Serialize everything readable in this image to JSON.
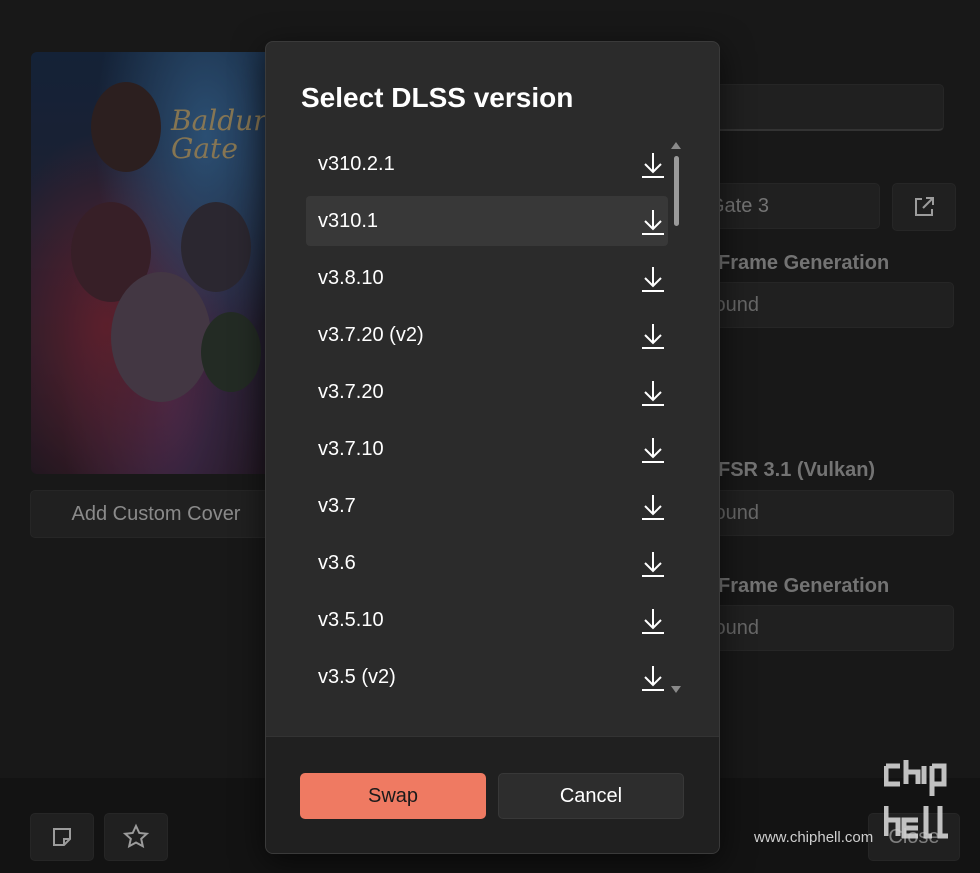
{
  "background": {
    "add_cover_label": "Add Custom Cover",
    "cover_art_text": "Baldur's Gate",
    "game_name_field": "Gate 3",
    "section_labels": [
      "Frame Generation",
      "FSR 3.1 (Vulkan)",
      "Frame Generation"
    ],
    "status_values": [
      "found",
      "found",
      "found"
    ],
    "close_label": "Close"
  },
  "dialog": {
    "title": "Select DLSS version",
    "versions": [
      {
        "label": "v310.2.1",
        "selected": false
      },
      {
        "label": "v310.1",
        "selected": true
      },
      {
        "label": "v3.8.10",
        "selected": false
      },
      {
        "label": "v3.7.20 (v2)",
        "selected": false
      },
      {
        "label": "v3.7.20",
        "selected": false
      },
      {
        "label": "v3.7.10",
        "selected": false
      },
      {
        "label": "v3.7",
        "selected": false
      },
      {
        "label": "v3.6",
        "selected": false
      },
      {
        "label": "v3.5.10",
        "selected": false
      },
      {
        "label": "v3.5 (v2)",
        "selected": false
      }
    ],
    "item_icon": "download-icon",
    "swap_label": "Swap",
    "cancel_label": "Cancel",
    "accent_color": "#ef7a62"
  },
  "watermark": {
    "url": "www.chiphell.com",
    "logo": "chip hell"
  }
}
